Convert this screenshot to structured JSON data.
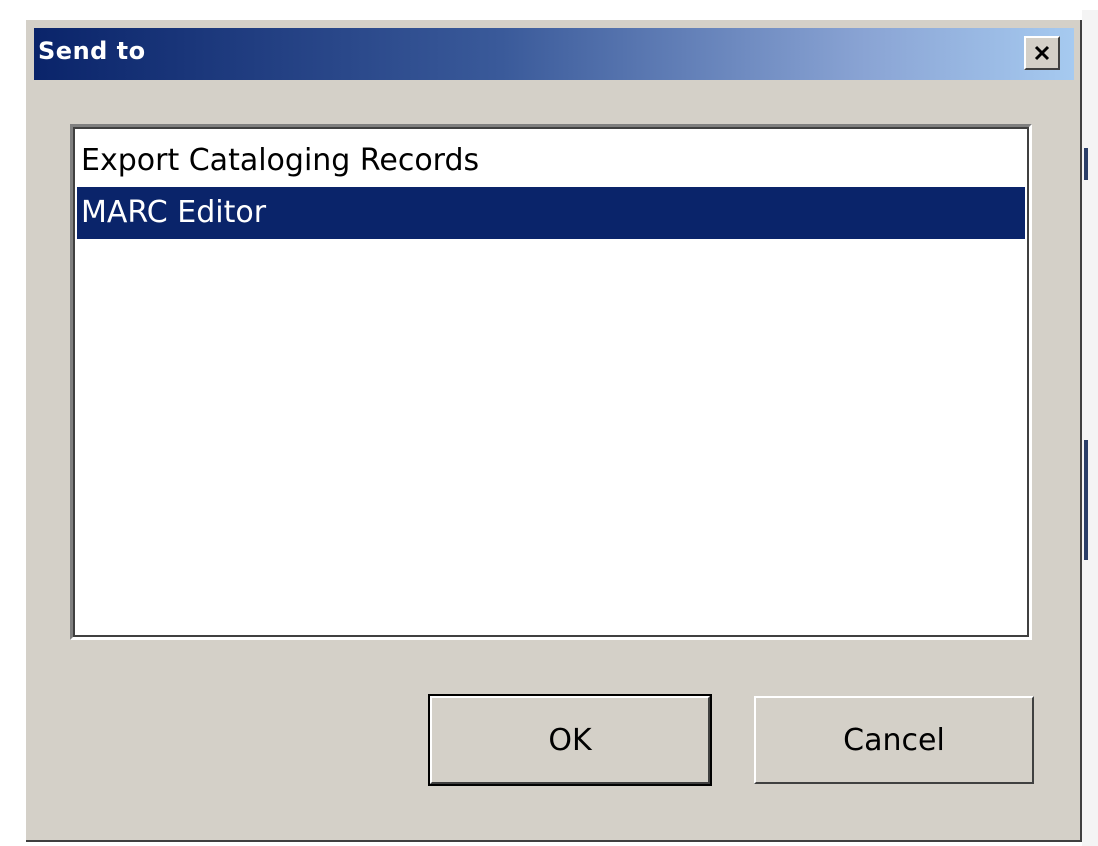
{
  "window": {
    "title": "Send to",
    "close_icon": "close-icon"
  },
  "list": {
    "items": [
      {
        "label": "Export Cataloging Records",
        "selected": false
      },
      {
        "label": "MARC Editor",
        "selected": true
      }
    ]
  },
  "buttons": {
    "ok_label": "OK",
    "cancel_label": "Cancel"
  },
  "colors": {
    "title_bar_start": "#0a246a",
    "title_bar_end": "#a6caf0",
    "selection": "#0a246a",
    "dialog_face": "#d4d0c8"
  }
}
